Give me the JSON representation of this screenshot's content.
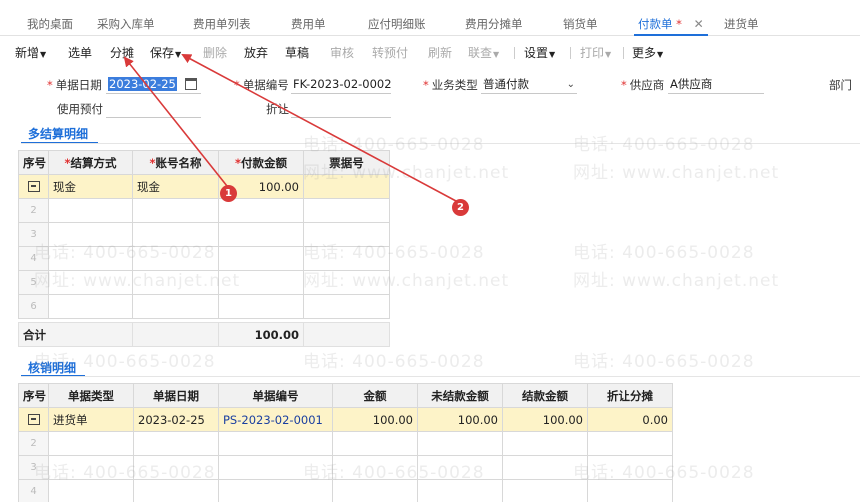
{
  "tabs": [
    {
      "label": "我的桌面"
    },
    {
      "label": "采购入库单"
    },
    {
      "label": "费用单列表"
    },
    {
      "label": "费用单"
    },
    {
      "label": "应付明细账"
    },
    {
      "label": "费用分摊单"
    },
    {
      "label": "销货单"
    },
    {
      "label": "付款单",
      "marker": "*",
      "active": true
    },
    {
      "label": "进货单"
    }
  ],
  "toolbar": {
    "new": "新增",
    "select_doc": "选单",
    "allocate": "分摊",
    "save": "保存",
    "delete": "删除",
    "abandon": "放弃",
    "draft": "草稿",
    "audit": "审核",
    "to_prepay": "转预付",
    "refresh": "刷新",
    "linked_query": "联查",
    "settings": "设置",
    "print": "打印",
    "more": "更多"
  },
  "form": {
    "doc_date_label": "单据日期",
    "doc_date_value": "2023-02-25",
    "doc_no_label": "单据编号",
    "doc_no_value": "FK-2023-02-0002",
    "biz_type_label": "业务类型",
    "biz_type_value": "普通付款",
    "supplier_label": "供应商",
    "supplier_value": "A供应商",
    "dept_label": "部门",
    "use_prepay_label": "使用预付",
    "discount_label": "折让"
  },
  "settlement": {
    "title": "多结算明细",
    "columns": [
      "序号",
      "结算方式",
      "账号名称",
      "付款金额",
      "票据号"
    ],
    "required_cols": [
      1,
      2,
      3
    ],
    "rows": [
      {
        "num": "",
        "method": "现金",
        "account": "现金",
        "amount": "100.00",
        "bill_no": ""
      },
      {
        "num": "2",
        "method": "",
        "account": "",
        "amount": "",
        "bill_no": ""
      },
      {
        "num": "3",
        "method": "",
        "account": "",
        "amount": "",
        "bill_no": ""
      },
      {
        "num": "4",
        "method": "",
        "account": "",
        "amount": "",
        "bill_no": ""
      },
      {
        "num": "5",
        "method": "",
        "account": "",
        "amount": "",
        "bill_no": ""
      },
      {
        "num": "6",
        "method": "",
        "account": "",
        "amount": "",
        "bill_no": ""
      }
    ],
    "total_label": "合计",
    "total_amount": "100.00"
  },
  "writeoff": {
    "title": "核销明细",
    "columns": [
      "序号",
      "单据类型",
      "单据日期",
      "单据编号",
      "金额",
      "未结款金额",
      "结款金额",
      "折让分摊"
    ],
    "rows": [
      {
        "num": "",
        "type": "进货单",
        "date": "2023-02-25",
        "doc_no": "PS-2023-02-0001",
        "amount": "100.00",
        "unsettled": "100.00",
        "settled": "100.00",
        "discount": "0.00"
      },
      {
        "num": "2",
        "type": "",
        "date": "",
        "doc_no": "",
        "amount": "",
        "unsettled": "",
        "settled": "",
        "discount": ""
      },
      {
        "num": "3",
        "type": "",
        "date": "",
        "doc_no": "",
        "amount": "",
        "unsettled": "",
        "settled": "",
        "discount": ""
      },
      {
        "num": "4",
        "type": "",
        "date": "",
        "doc_no": "",
        "amount": "",
        "unsettled": "",
        "settled": "",
        "discount": ""
      }
    ]
  },
  "watermark": {
    "phone": "电话: 400-665-0028",
    "site": "网址: www.chanjet.net"
  },
  "annotations": [
    "1",
    "2"
  ],
  "colors": {
    "accent": "#1e6fd9",
    "required": "#e03030",
    "selected_row": "#fdf3c8",
    "annotation": "#d93a3a"
  }
}
